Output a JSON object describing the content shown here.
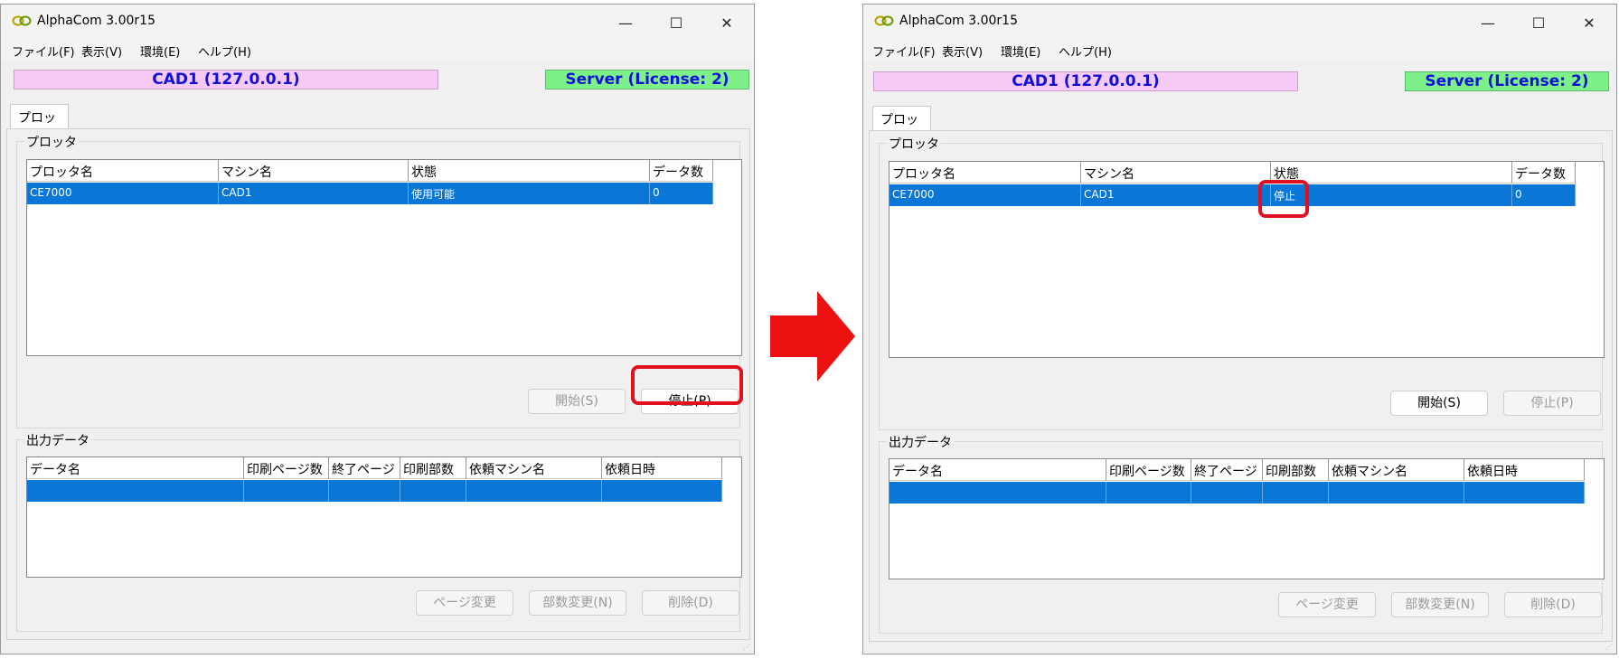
{
  "windows": [
    {
      "title": "AlphaCom 3.00r15",
      "menus": [
        "ファイル(F)",
        "表示(V)",
        "環境(E)",
        "ヘルプ(H)"
      ],
      "machine_banner": "CAD1 (127.0.0.1)",
      "server_banner": "Server (License: 2)",
      "tab": "プロッタ",
      "plotter_group_title": "プロッタ",
      "plotter_columns": [
        "プロッタ名",
        "マシン名",
        "状態",
        "データ数"
      ],
      "plotter_row": [
        "CE7000",
        "CAD1",
        "使用可能",
        "0"
      ],
      "start_button": "開始(S)",
      "stop_button": "停止(P)",
      "output_group_title": "出力データ",
      "output_columns": [
        "データ名",
        "印刷ページ数",
        "終了ページ",
        "印刷部数",
        "依頼マシン名",
        "依頼日時"
      ],
      "page_button": "ページ変更",
      "copies_button": "部数変更(N)",
      "delete_button": "削除(D)"
    },
    {
      "title": "AlphaCom 3.00r15",
      "menus": [
        "ファイル(F)",
        "表示(V)",
        "環境(E)",
        "ヘルプ(H)"
      ],
      "machine_banner": "CAD1 (127.0.0.1)",
      "server_banner": "Server (License: 2)",
      "tab": "プロッタ",
      "plotter_group_title": "プロッタ",
      "plotter_columns": [
        "プロッタ名",
        "マシン名",
        "状態",
        "データ数"
      ],
      "plotter_row": [
        "CE7000",
        "CAD1",
        "停止",
        "0"
      ],
      "start_button": "開始(S)",
      "stop_button": "停止(P)",
      "output_group_title": "出力データ",
      "output_columns": [
        "データ名",
        "印刷ページ数",
        "終了ページ",
        "印刷部数",
        "依頼マシン名",
        "依頼日時"
      ],
      "page_button": "ページ変更",
      "copies_button": "部数変更(N)",
      "delete_button": "削除(D)"
    }
  ],
  "colors": {
    "selection": "#0a77d6",
    "machine_banner_bg": "#f7c9f7",
    "server_banner_bg": "#7df08a",
    "banner_text": "#1010d8",
    "highlight": "#e01020",
    "arrow": "#ee1111"
  }
}
